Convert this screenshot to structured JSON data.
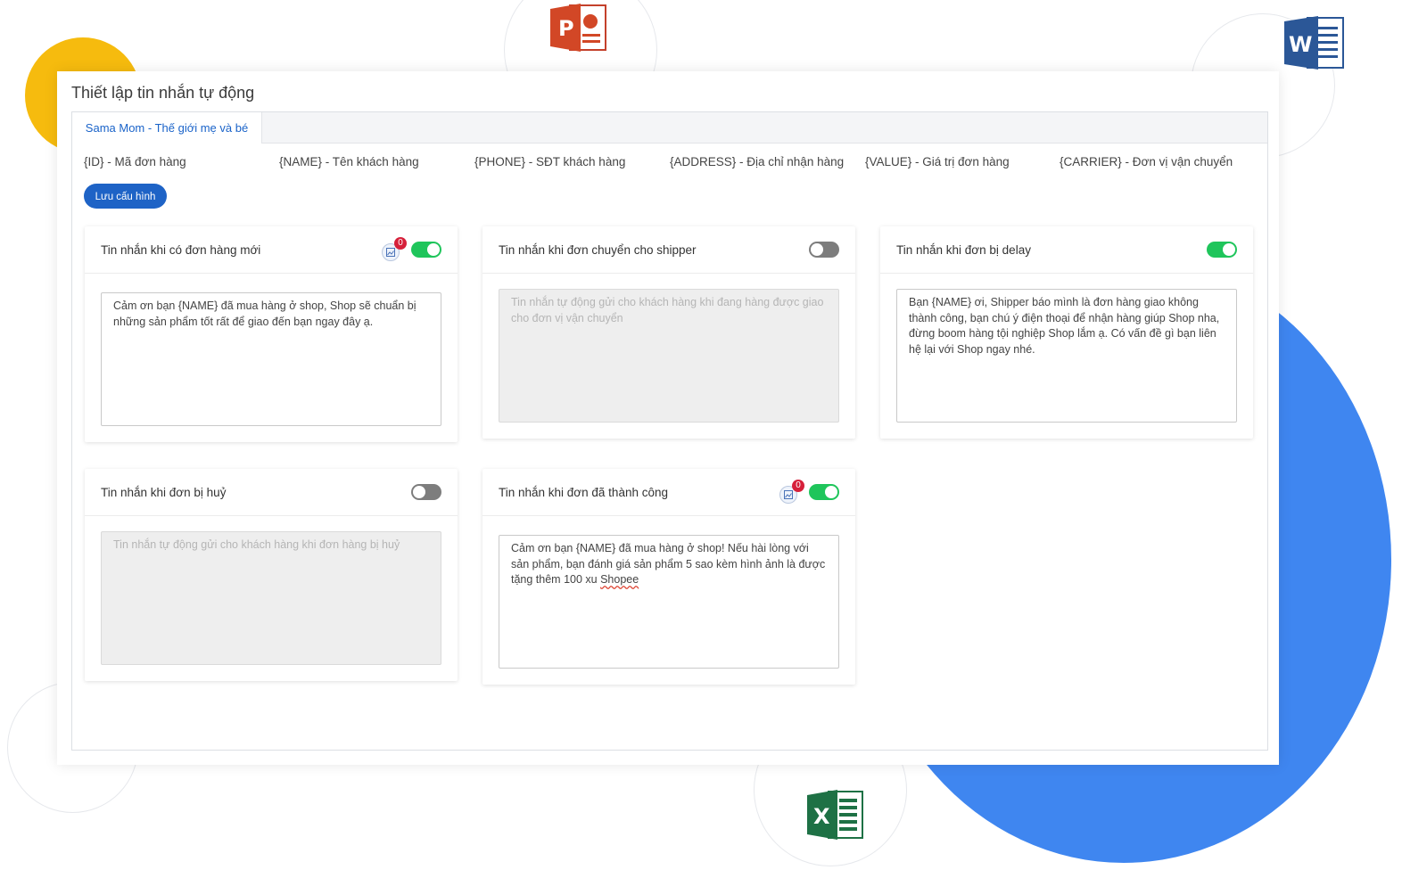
{
  "panel": {
    "title": "Thiết lập tin nhắn tự động",
    "tab": "Sama Mom - Thế giới mẹ và bé",
    "variables": [
      "{ID} - Mã đơn hàng",
      "{NAME} - Tên khách hàng",
      "{PHONE} - SĐT khách hàng",
      "{ADDRESS} - Địa chỉ nhận hàng",
      "{VALUE} - Giá trị đơn hàng",
      "{CARRIER} - Đơn vị vận chuyển"
    ],
    "save_label": "Lưu cấu hình"
  },
  "cards": [
    {
      "title": "Tin nhắn khi có đơn hàng mới",
      "enabled": true,
      "image_count": "0",
      "text": "Cảm ơn bạn {NAME} đã mua hàng ở shop, Shop sẽ chuẩn bị những sản phẩm tốt rất để giao đến bạn ngay đây ạ.",
      "placeholder": ""
    },
    {
      "title": "Tin nhắn khi đơn chuyển cho shipper",
      "enabled": false,
      "text": "",
      "placeholder": "Tin nhắn tự động gửi cho khách hàng khi đang hàng được giao cho đơn vị vận chuyển"
    },
    {
      "title": "Tin nhắn khi đơn bị delay",
      "enabled": true,
      "text": "Bạn {NAME}  ơi, Shipper báo mình là đơn hàng giao không thành công, bạn chú ý điện thoại để nhận hàng giúp Shop nha, đừng boom hàng tội nghiệp Shop lắm ạ. Có vấn đề gì bạn liên hệ lại với Shop ngay nhé.",
      "placeholder": ""
    },
    {
      "title": "Tin nhắn khi đơn bị huỷ",
      "enabled": false,
      "text": "",
      "placeholder": "Tin nhắn tự động gửi cho khách hàng khi đơn hàng bị huỷ"
    },
    {
      "title": "Tin nhắn khi đơn đã thành công",
      "enabled": true,
      "image_count": "0",
      "text_main": "Cảm ơn bạn {NAME} đã mua hàng ở shop! Nếu hài lòng với sản phẩm, bạn đánh giá sản phẩm 5 sao kèm hình ảnh là được tặng thêm 100 xu ",
      "text_underlined": "Shopee",
      "placeholder": ""
    }
  ],
  "icons": [
    "powerpoint-icon",
    "word-icon",
    "excel-icon",
    "image-icon"
  ],
  "colors": {
    "accent": "#1e63c6",
    "toggle_on": "#1fc55b",
    "toggle_off": "#7d7d7d",
    "badge": "#d6203a"
  }
}
